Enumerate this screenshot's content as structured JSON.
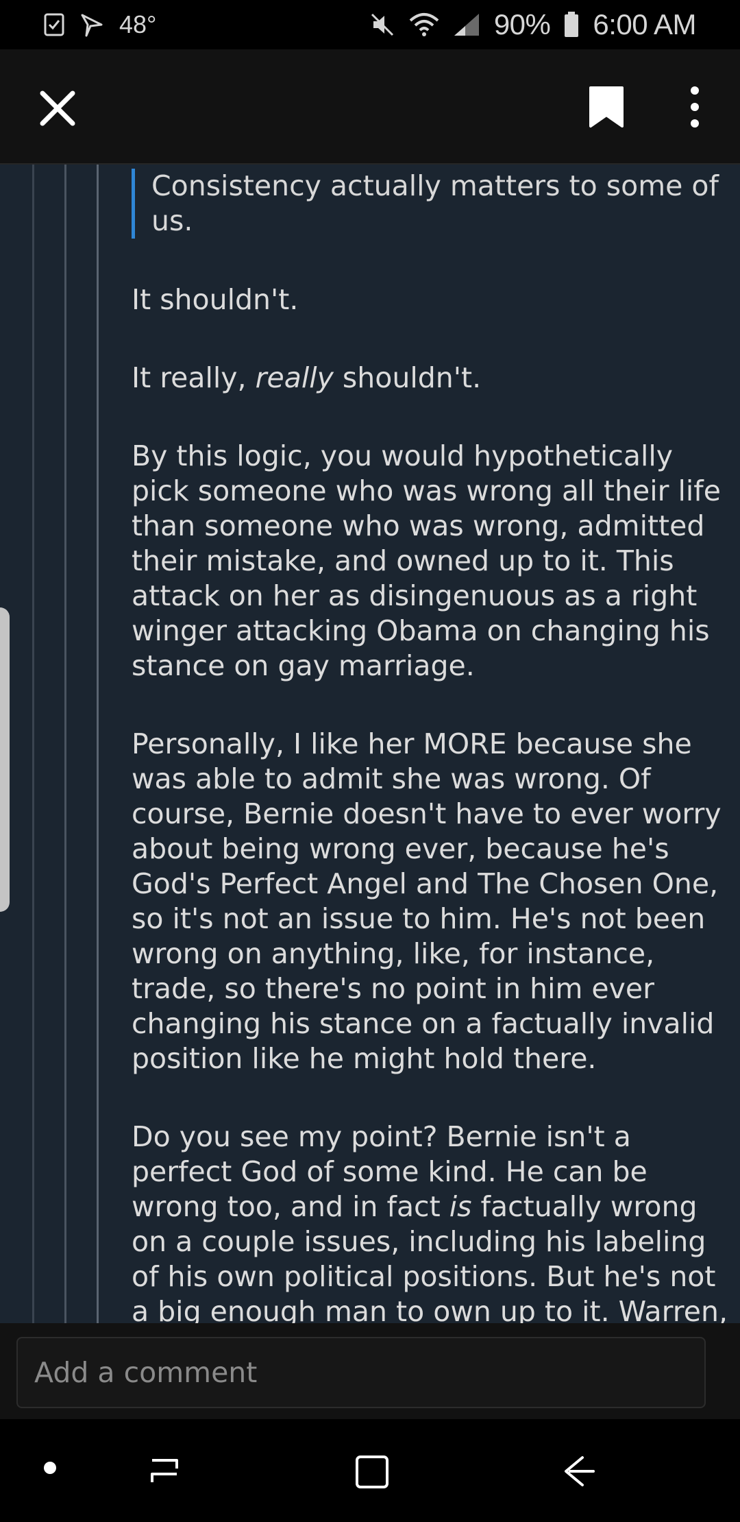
{
  "status_bar": {
    "temperature": "48°",
    "battery": "90%",
    "time": "6:00 AM"
  },
  "toolbar": {
    "close_icon": "close-icon",
    "bookmark_icon": "bookmark-icon",
    "more_icon": "more-vertical-icon"
  },
  "comment": {
    "quote": "Consistency actually matters to some of us.",
    "paragraphs": [
      "It shouldn't.",
      {
        "before": "It really, ",
        "emphasis": "really",
        "after": " shouldn't."
      },
      "By this logic, you would hypothetically pick someone who was wrong all their life than someone who was wrong, admitted their mistake, and owned up to it.  This attack on her as disingenuous as a right winger attacking Obama on changing his stance on gay marriage.",
      "Personally, I like her MORE because she was able to admit she was wrong.  Of course, Bernie doesn't have to ever worry about being wrong ever, because he's God's Perfect Angel and The Chosen One, so it's not an issue to him.  He's not been wrong on anything, like, for instance, trade, so there's no point in him ever changing his stance on a factually invalid position like he might hold there.",
      {
        "before": "Do you see my point?  Bernie isn't a perfect God of some kind.  He can be wrong too, and in fact ",
        "emphasis": "is",
        "after": " factually wrong on a couple issues, including his labeling of his own political positions.  But he's not a big enough man to own up to it.  Warren, ironically, is."
      }
    ]
  },
  "comment_bar": {
    "placeholder": "Add a comment"
  },
  "nav_bar": {
    "home_icon": "dot-icon",
    "recents_icon": "recents-icon",
    "overview_icon": "square-icon",
    "back_icon": "back-arrow-icon"
  },
  "colors": {
    "background": "#1b2530",
    "toolbar": "#121212",
    "quote_bar": "#2f86d6",
    "text": "#dcdcdc"
  }
}
